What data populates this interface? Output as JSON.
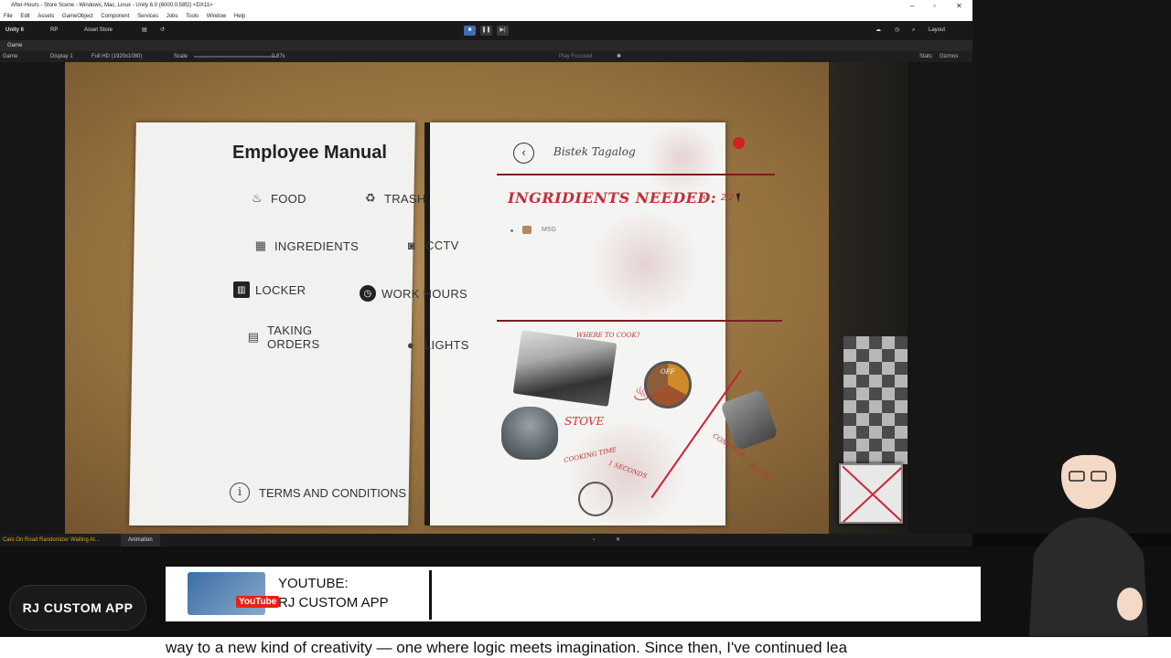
{
  "window": {
    "title": "After-Hours - Store Scene - Windows, Mac, Linux - Unity 6.0 (6000.0.58f2) <DX11>"
  },
  "menu": [
    "File",
    "Edit",
    "Assets",
    "GameObject",
    "Component",
    "Services",
    "Jobs",
    "Tools",
    "Window",
    "Help"
  ],
  "toolbar": {
    "unity": "Unity 6",
    "rp": "RP",
    "asset_store": "Asset Store",
    "layout": "Layout"
  },
  "game_view": {
    "tab": "Game",
    "mode": "Game",
    "display": "Display 1",
    "resolution": "Full HD (1920x1080)",
    "scale_label": "Scale",
    "scale_value": "0.87x",
    "play_focused": "Play Focused",
    "stats": "Stats",
    "gizmos": "Gizmos"
  },
  "manual": {
    "title": "Employee Manual",
    "topics": {
      "food": "FOOD",
      "trash": "TRASH",
      "ingredients": "INGREDIENTS",
      "cctv": "CCTV",
      "locker": "LOCKER",
      "work_hours": "WORK HOURS",
      "taking_orders_1": "TAKING",
      "taking_orders_2": "ORDERS",
      "lights": "LIGHTS"
    },
    "terms": "TERMS AND CONDITIONS",
    "recipe": "Bistek Tagalog",
    "ingredients_title": "INGRIDIENTS NEEDED:",
    "pager": "2/2",
    "ingredient_items": [
      "MSG"
    ],
    "hints": {
      "where": "WHERE TO COOK?",
      "stove": "STOVE",
      "cooking_time_1": "COOKING TIME",
      "cooking_time_2": "1 SECONDS",
      "continue_1": "CONTINUE",
      "continue_2": "TO USE",
      "dial_off": "OFF"
    }
  },
  "status": {
    "console": "Cars On Road Randomizer Waiting At...",
    "animation_tab": "Animation"
  },
  "overlay": {
    "logo": "RJ CUSTOM APP",
    "yt_badge": "YouTube",
    "yt_line1": "YOUTUBE:",
    "yt_line2": "RJ CUSTOM APP",
    "ticker": "way to a new kind of creativity — one where logic meets imagination. Since then, I've continued lea"
  }
}
